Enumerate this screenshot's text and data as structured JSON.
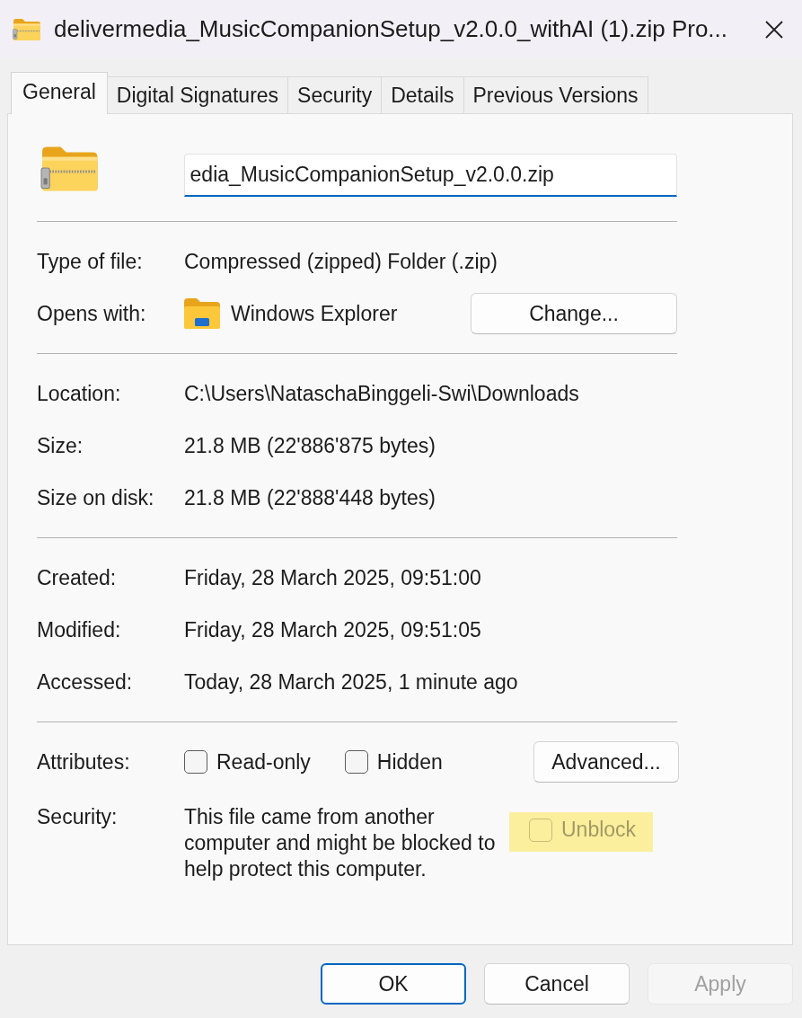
{
  "window": {
    "title": "delivermedia_MusicCompanionSetup_v2.0.0_withAI (1).zip Pro..."
  },
  "tabs": [
    {
      "label": "General",
      "selected": true
    },
    {
      "label": "Digital Signatures",
      "selected": false
    },
    {
      "label": "Security",
      "selected": false
    },
    {
      "label": "Details",
      "selected": false
    },
    {
      "label": "Previous Versions",
      "selected": false
    }
  ],
  "file_name": {
    "value": "edia_MusicCompanionSetup_v2.0.0.zip"
  },
  "sections": [
    {
      "rows": [
        {
          "kind": "text",
          "label": "Type of file:",
          "value": "Compressed (zipped) Folder (.zip)"
        },
        {
          "kind": "app",
          "label": "Opens with:",
          "value": "Windows Explorer",
          "button": "Change..."
        }
      ]
    },
    {
      "rows": [
        {
          "kind": "text",
          "label": "Location:",
          "value": "C:\\Users\\NataschaBinggeli-Swi\\Downloads"
        },
        {
          "kind": "text",
          "label": "Size:",
          "value": "21.8 MB (22'886'875 bytes)"
        },
        {
          "kind": "text",
          "label": "Size on disk:",
          "value": "21.8 MB (22'888'448 bytes)"
        }
      ]
    },
    {
      "rows": [
        {
          "kind": "text",
          "label": "Created:",
          "value": "Friday, 28 March 2025, 09:51:00"
        },
        {
          "kind": "text",
          "label": "Modified:",
          "value": "Friday, 28 March 2025, 09:51:05"
        },
        {
          "kind": "text",
          "label": "Accessed:",
          "value": "Today, 28 March 2025, 1 minute ago"
        }
      ]
    },
    {
      "rows": [
        {
          "kind": "attributes",
          "label": "Attributes:",
          "checkboxes": [
            {
              "label": "Read-only",
              "checked": false,
              "disabled": false
            },
            {
              "label": "Hidden",
              "checked": false,
              "disabled": false
            }
          ],
          "button": "Advanced..."
        },
        {
          "kind": "security",
          "label": "Security:",
          "value": "This file came from another computer and might be blocked to help protect this computer.",
          "checkbox": {
            "label": "Unblock",
            "checked": false,
            "disabled": true,
            "highlighted": true
          }
        }
      ]
    }
  ],
  "buttons": [
    {
      "label": "OK",
      "default": true,
      "disabled": false
    },
    {
      "label": "Cancel",
      "default": false,
      "disabled": false
    },
    {
      "label": "Apply",
      "default": false,
      "disabled": true
    }
  ]
}
